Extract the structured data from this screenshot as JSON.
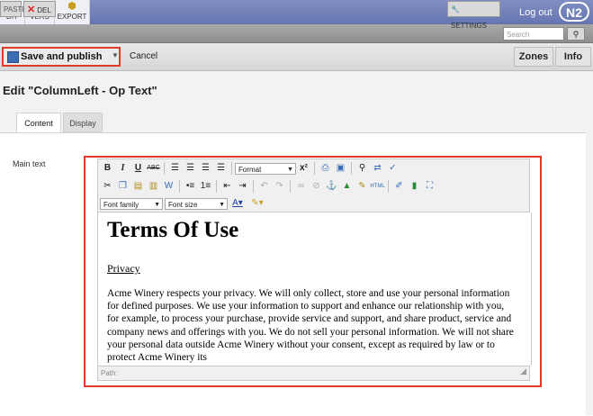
{
  "topbar": {
    "buttons": [
      {
        "label": "DIT",
        "icon": "edit-icon"
      },
      {
        "label": "VERS",
        "icon": "versions-icon"
      },
      {
        "label": "EXPORT",
        "icon": "export-icon"
      }
    ],
    "logout_label": "Log out",
    "logo_text": "N2"
  },
  "toolbar2": {
    "paste_label": "PASTE",
    "delete_label": "DEL",
    "settings_label": "SETTINGS",
    "search_placeholder": "Search"
  },
  "actions": {
    "save_label": "Save and publish",
    "cancel_label": "Cancel",
    "zones_label": "Zones",
    "info_label": "Info"
  },
  "page": {
    "title": "Edit \"ColumnLeft - Op Text\"",
    "tabs": [
      {
        "label": "Content",
        "active": true
      },
      {
        "label": "Display",
        "active": false
      }
    ],
    "field_label": "Main text"
  },
  "editor": {
    "format_select": "Format",
    "font_family_select": "Font family",
    "font_size_select": "Font size",
    "path_label": "Path:",
    "content": {
      "heading": "Terms Of Use",
      "subheading": "Privacy",
      "body": "Acme Winery respects your privacy. We will only collect, store and use your personal information for defined purposes. We use your information to support and enhance our relationship with you, for example, to process your purchase, provide service and support, and share product, service and company news and offerings with you. We do not sell your personal information. We will not share your personal data outside Acme Winery without your consent, except as required by law or to protect Acme Winery its"
    }
  },
  "colors": {
    "highlight_border": "#e23b2e",
    "topbar": "#6f7fba"
  }
}
